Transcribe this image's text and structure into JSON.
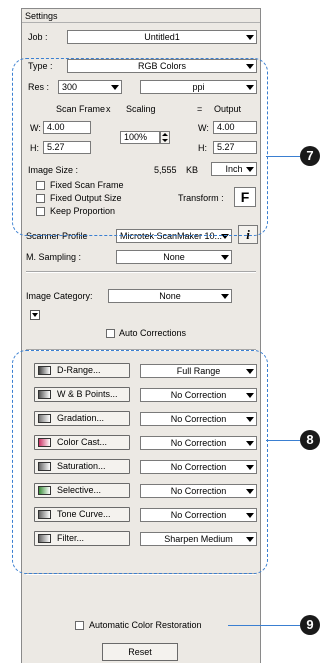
{
  "window": {
    "title": "Settings"
  },
  "job": {
    "label": "Job :",
    "value": "Untitled1"
  },
  "type": {
    "label": "Type :",
    "value": "RGB Colors"
  },
  "res": {
    "label": "Res :",
    "value": "300",
    "unit": "ppi"
  },
  "scan": {
    "scan_frame_label": "Scan Frame",
    "x_label": "x",
    "scaling_label": "Scaling",
    "eq_label": "=",
    "output_label": "Output",
    "w_label": "W:",
    "h_label": "H:",
    "scan_w": "4.00",
    "scan_h": "5.27",
    "scaling": "100%",
    "out_w": "4.00",
    "out_h": "5.27"
  },
  "image_size": {
    "label": "Image Size :",
    "value": "5,555",
    "unit": "KB",
    "unit_select": "Inch"
  },
  "options": {
    "fixed_scan_frame": "Fixed Scan Frame",
    "fixed_output_size": "Fixed Output Size",
    "keep_proportion": "Keep Proportion",
    "transform_label": "Transform :",
    "transform_glyph": "F"
  },
  "scanner_profile": {
    "label": "Scanner Profile",
    "value": "Microtek ScanMaker 10...",
    "info_glyph": "i"
  },
  "m_sampling": {
    "label": "M. Sampling :",
    "value": "None"
  },
  "image_category": {
    "label": "Image Category:",
    "value": "None"
  },
  "auto_corrections": {
    "label": "Auto Corrections"
  },
  "tools": [
    {
      "button": "D-Range...",
      "value": "Full Range",
      "icon": "d-range-icon",
      "color": "#444444"
    },
    {
      "button": "W & B Points...",
      "value": "No Correction",
      "icon": "wb-points-icon",
      "color": "#555555"
    },
    {
      "button": "Gradation...",
      "value": "No Correction",
      "icon": "gradation-icon",
      "color": "#777777"
    },
    {
      "button": "Color Cast...",
      "value": "No Correction",
      "icon": "color-cast-icon",
      "color": "#cc3366"
    },
    {
      "button": "Saturation...",
      "value": "No Correction",
      "icon": "saturation-icon",
      "color": "#666666"
    },
    {
      "button": "Selective...",
      "value": "No Correction",
      "icon": "selective-icon",
      "color": "#3c8f3c"
    },
    {
      "button": "Tone Curve...",
      "value": "No Correction",
      "icon": "tone-curve-icon",
      "color": "#666666"
    },
    {
      "button": "Filter...",
      "value": "Sharpen Medium",
      "icon": "filter-icon",
      "color": "#666666"
    }
  ],
  "automatic_color_restoration": {
    "label": "Automatic Color Restoration"
  },
  "reset": {
    "label": "Reset"
  },
  "callouts": [
    "7",
    "8",
    "9"
  ],
  "accent_color": "#3a7fd1"
}
